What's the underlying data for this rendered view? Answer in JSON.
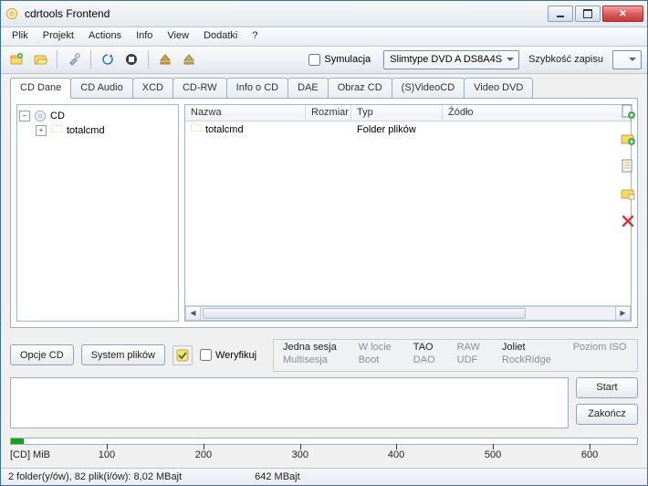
{
  "title": "cdrtools Frontend",
  "menu": [
    "Plik",
    "Projekt",
    "Actions",
    "Info",
    "View",
    "Dodatki",
    "?"
  ],
  "toolbar": {
    "simulation_label": "Symulacja",
    "drive_selected": "Slimtype DVD A DS8A4S",
    "speed_label": "Szybkość zapisu"
  },
  "tabs": [
    "CD Dane",
    "CD Audio",
    "XCD",
    "CD-RW",
    "Info o CD",
    "DAE",
    "Obraz CD",
    "(S)VideoCD",
    "Video DVD"
  ],
  "active_tab": 0,
  "tree": {
    "root": "CD",
    "children": [
      "totalcmd"
    ]
  },
  "columns": {
    "name": "Nazwa",
    "size": "Rozmiar",
    "type": "Typ",
    "source": "Źódło"
  },
  "rows": [
    {
      "name": "totalcmd",
      "size": "",
      "type": "Folder plików",
      "source": ""
    }
  ],
  "buttons": {
    "opcje": "Opcje CD",
    "fs": "System plików",
    "verify": "Weryfikuj",
    "start": "Start",
    "zakoncz": "Zakończ"
  },
  "opts": {
    "col1": {
      "sel": "Jedna sesja",
      "alt": "Multisesja"
    },
    "col2": {
      "sel": "W locie",
      "alt": "Boot"
    },
    "col3": {
      "sel": "TAO",
      "alt": "DAO"
    },
    "col4": {
      "sel": "RAW",
      "alt": "UDF"
    },
    "col5": {
      "sel": "Joliet",
      "alt": "RockRidge"
    },
    "col6": {
      "sel": "Poziom ISO",
      "alt": ""
    }
  },
  "ruler": {
    "unit": "[CD] MiB",
    "ticks": [
      "100",
      "200",
      "300",
      "400",
      "500",
      "600"
    ]
  },
  "status": {
    "left": "2 folder(y/ów), 82 plik(i/ów): 8,02 MBajt",
    "right": "642 MBajt"
  }
}
